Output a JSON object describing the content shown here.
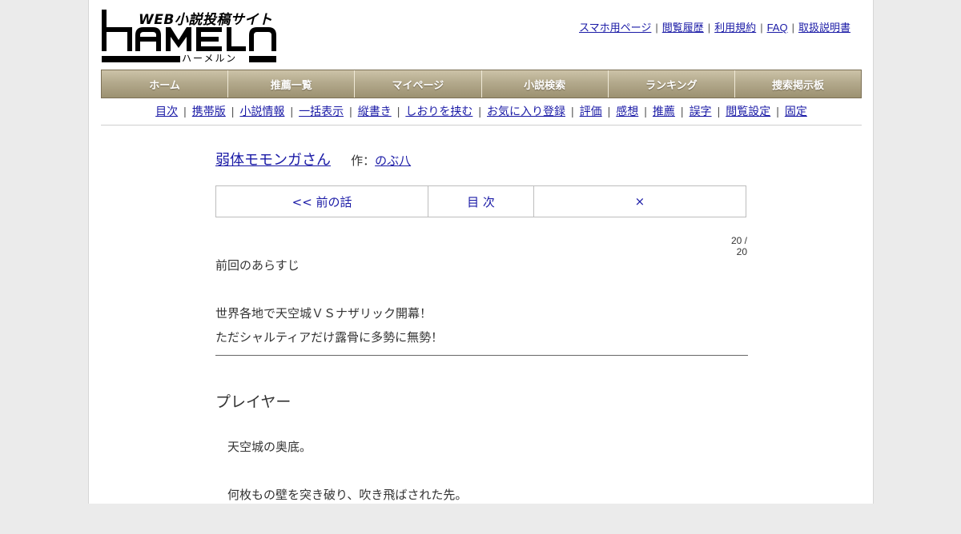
{
  "logo": {
    "tagline": "WEB小説投稿サイト",
    "wordmark": "HAMELN",
    "kana": "ハーメルン"
  },
  "header_links": [
    "スマホ用ページ",
    "閲覧履歴",
    "利用規約",
    "FAQ",
    "取扱説明書"
  ],
  "global_nav": [
    "ホーム",
    "推薦一覧",
    "マイページ",
    "小説検索",
    "ランキング",
    "捜索掲示板"
  ],
  "sub_nav": [
    "目次",
    "携帯版",
    "小説情報",
    "一括表示",
    "縦書き",
    "しおりを挟む",
    "お気に入り登録",
    "評価",
    "感想",
    "推薦",
    "誤字",
    "閲覧設定",
    "固定"
  ],
  "novel": {
    "title": "弱体モモンガさん",
    "author_label": "作：",
    "author": "のぶ八"
  },
  "chapter_nav": {
    "prev": "<< 前の話",
    "toc": "目 次",
    "next": "×"
  },
  "page_count": "20 / 20",
  "synopsis": [
    "前回のあらすじ",
    "",
    "世界各地で天空城ＶＳナザリック開幕！",
    "ただシャルティアだけ露骨に多勢に無勢！"
  ],
  "chapter_title": "プレイヤー",
  "body": [
    "天空城の奥底。",
    "何枚もの壁を突き破り、吹き飛ばされた先。"
  ],
  "colors": {
    "nav_gradient_top": "#ccc3a8",
    "nav_gradient_bottom": "#9c9171",
    "link": "#1a1aa6"
  }
}
